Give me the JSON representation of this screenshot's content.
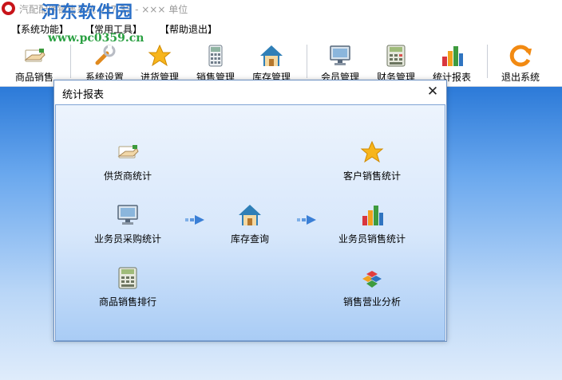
{
  "window": {
    "title": "汽配配件销售系统 v37.33 - ××× 单位",
    "watermark": "河东软件园",
    "watermark_url": "www.pc0359.cn"
  },
  "menu": [
    {
      "label": "【系统功能】"
    },
    {
      "label": "【常用工具】"
    },
    {
      "label": "【帮助退出】"
    }
  ],
  "toolbar": [
    {
      "label": "商品销售",
      "icon": "hand-card-icon"
    },
    {
      "label": "系统设置",
      "icon": "wrench-icon"
    },
    {
      "label": "进货管理",
      "icon": "star-icon"
    },
    {
      "label": "销售管理",
      "icon": "calculator-icon"
    },
    {
      "label": "库存管理",
      "icon": "house-icon"
    },
    {
      "label": "会员管理",
      "icon": "monitor-icon"
    },
    {
      "label": "财务管理",
      "icon": "cash-register-icon"
    },
    {
      "label": "统计报表",
      "icon": "bar-chart-icon"
    },
    {
      "label": "退出系统",
      "icon": "exit-icon"
    }
  ],
  "dialog": {
    "title": "统计报表",
    "close": "✕",
    "items": {
      "supplier_stats": {
        "label": "供货商统计",
        "icon": "hand-card-icon"
      },
      "customer_sales_stats": {
        "label": "客户销售统计",
        "icon": "star-icon"
      },
      "staff_purchase_stats": {
        "label": "业务员采购统计",
        "icon": "monitor-icon"
      },
      "inventory_query": {
        "label": "库存查询",
        "icon": "house-icon"
      },
      "staff_sales_stats": {
        "label": "业务员销售统计",
        "icon": "bar-chart-icon"
      },
      "product_sales_rank": {
        "label": "商品销售排行",
        "icon": "calculator-icon"
      },
      "sales_analysis": {
        "label": "销售营业分析",
        "icon": "cubes-icon"
      }
    }
  },
  "colors": {
    "workspace_top": "#2c7ad8",
    "workspace_bottom": "#dfecfb",
    "dialog_border": "#6a8fc1",
    "watermark": "#2a6fc7",
    "watermark_url": "#2aa042"
  }
}
